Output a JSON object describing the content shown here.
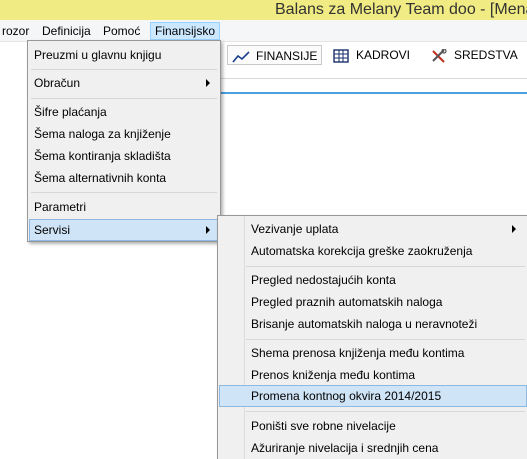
{
  "window": {
    "title": "Balans za Melany Team doo - [Menad"
  },
  "menubar": {
    "items": [
      {
        "label": "rozor"
      },
      {
        "label": "Definicija"
      },
      {
        "label": "Pomoć"
      },
      {
        "label": "Finansijsko"
      }
    ],
    "active": "Finansijsko"
  },
  "toolbar": {
    "tabs": [
      {
        "label": "FINANSIJE",
        "icon": "line-chart-icon"
      },
      {
        "label": "KADROVI",
        "icon": "grid-icon"
      },
      {
        "label": "SREDSTVA",
        "icon": "tools-icon"
      }
    ]
  },
  "finansijsko_menu": {
    "items": [
      {
        "label": "Preuzmi u glavnu knjigu"
      },
      {
        "label": "Obračun",
        "submenu": true
      },
      {
        "label": "Šifre plaćanja"
      },
      {
        "label": "Šema naloga za knjiženje"
      },
      {
        "label": "Šema kontiranja skladišta"
      },
      {
        "label": "Šema alternativnih konta"
      },
      {
        "label": "Parametri"
      },
      {
        "label": "Servisi",
        "submenu": true,
        "highlighted": true
      }
    ]
  },
  "servisi_menu": {
    "items": [
      {
        "label": "Vezivanje uplata",
        "submenu": true
      },
      {
        "label": "Automatska korekcija greške zaokruženja"
      },
      {
        "label": "Pregled nedostajućih konta"
      },
      {
        "label": "Pregled praznih automatskih naloga"
      },
      {
        "label": "Brisanje automatskih naloga u neravnoteži"
      },
      {
        "label": "Shema prenosa knjiženja među kontima"
      },
      {
        "label": "Prenos kniženja među kontima"
      },
      {
        "label": "Promena kontnog okvira 2014/2015",
        "highlighted": true
      },
      {
        "label": "Poništi sve robne nivelacije"
      },
      {
        "label": "Ažuriranje nivelacija i srednjih cena"
      }
    ]
  },
  "colors": {
    "titlebar": "#f1eb83",
    "menu_bg": "#f0f0f0",
    "highlight": "#cfe4f7",
    "highlight_border": "#8db9e2",
    "accent_strip": "#4aa0e0"
  }
}
